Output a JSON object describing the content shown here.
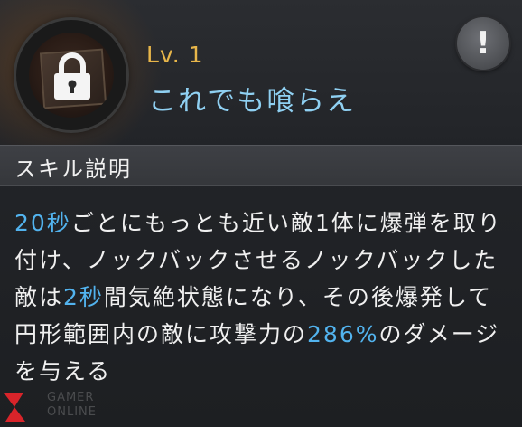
{
  "header": {
    "level": "Lv. 1",
    "skill_name": "これでも喰らえ",
    "icon": "lock-icon",
    "info_button": "!"
  },
  "section": {
    "title": "スキル説明"
  },
  "description": {
    "segments": [
      {
        "text": "20秒",
        "highlight": true
      },
      {
        "text": "ごとにもっとも近い敵1体に爆弾を取り付け、ノックバックさせるノックバックした敵は",
        "highlight": false
      },
      {
        "text": "2秒",
        "highlight": true
      },
      {
        "text": "間気絶状態になり、その後爆発して円形範囲内の敵に攻撃力の",
        "highlight": false
      },
      {
        "text": "286%",
        "highlight": true
      },
      {
        "text": "のダメージを与える",
        "highlight": false
      }
    ]
  },
  "colors": {
    "level": "#e8b64a",
    "skill_name": "#8fd0f2",
    "highlight": "#52b3ee",
    "text": "#f0f0f0"
  },
  "watermark": {
    "text_line1": "GAMER",
    "text_line2": "ONLINE"
  }
}
